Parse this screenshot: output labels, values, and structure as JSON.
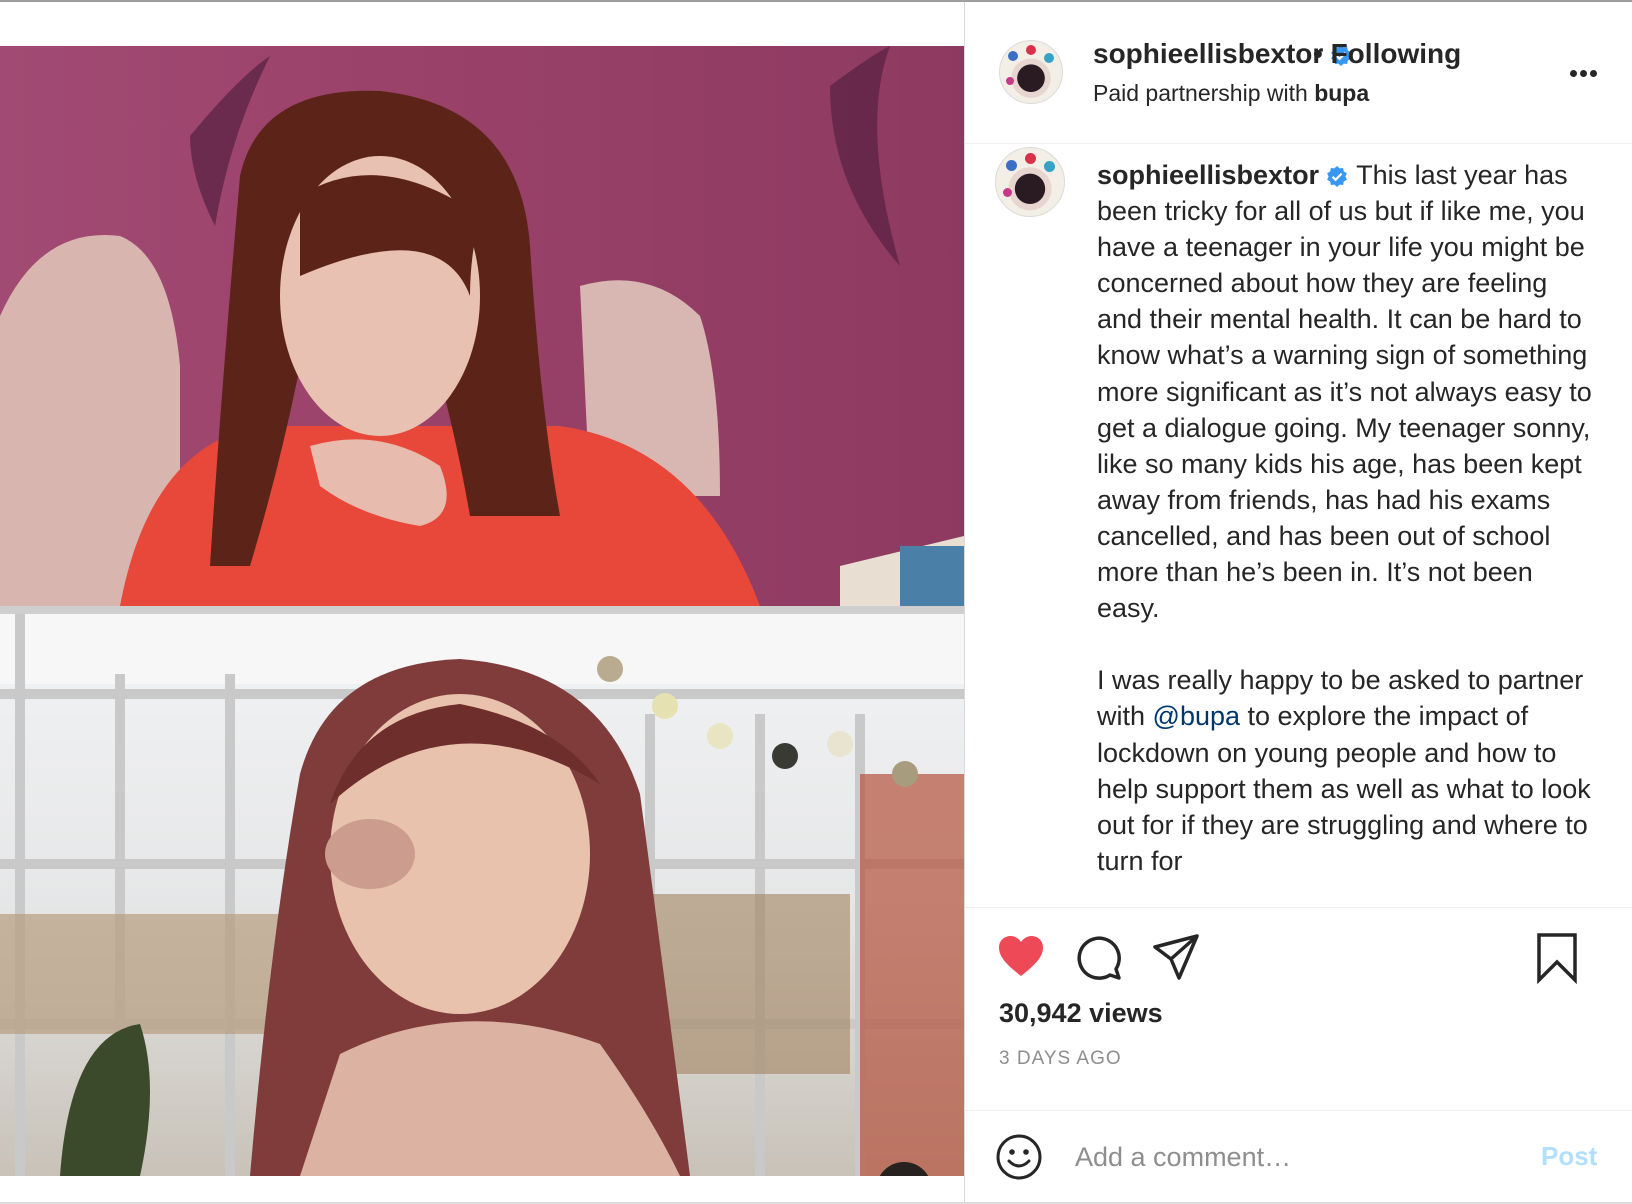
{
  "post": {
    "username": "sophieellisbextor",
    "following_label": "• Following",
    "paid_partnership_prefix": "Paid partnership with ",
    "partner": "bupa"
  },
  "caption": {
    "username": "sophieellisbextor",
    "part1": " This last year has been tricky for all of us but if like me, you have a teenager in your life you might be concerned about how they are feeling and their mental health. It can be hard to know what’s a warning sign of something more significant as it’s not always easy to get a dialogue going. My teenager sonny, like so many kids his age, has been kept away from friends, has had his exams cancelled, and has been out of school more than he’s been in. It’s not been easy.\n\nI was really happy to be asked to partner with ",
    "mention": "@bupa",
    "part2": " to explore the impact of lockdown on young people and how to help support them as well as what to look out for if they are struggling and where to turn for"
  },
  "stats": {
    "views": "30,942 views",
    "timestamp": "3 DAYS AGO"
  },
  "comment": {
    "placeholder": "Add a comment…",
    "post_label": "Post"
  },
  "colors": {
    "like": "#ed4956",
    "verified": "#3897f0",
    "post_disabled": "#b2dffc",
    "mention": "#00376b"
  },
  "icons": [
    "verified-icon",
    "more-options-icon",
    "heart-icon",
    "comment-icon",
    "share-icon",
    "bookmark-icon",
    "emoji-icon",
    "muted-speaker-icon"
  ]
}
